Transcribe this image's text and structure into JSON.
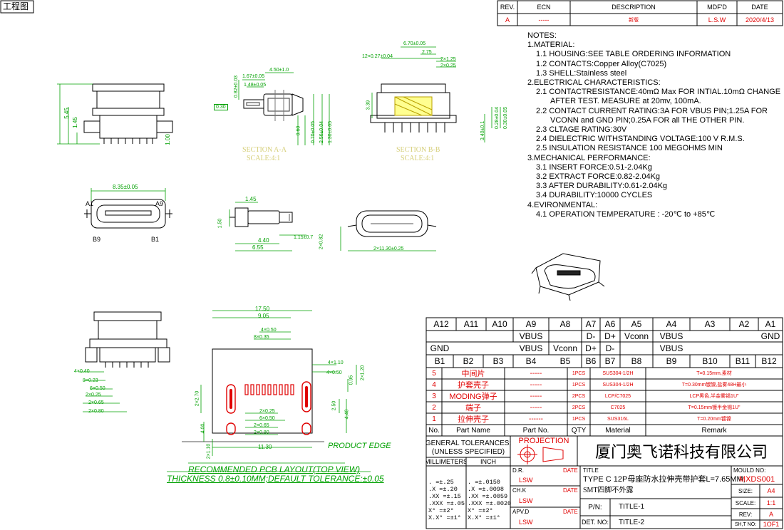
{
  "corner_tag": "工程图",
  "revision": {
    "headers": [
      "REV.",
      "ECN",
      "DESCRIPTION",
      "MDF'D",
      "DATE"
    ],
    "row": [
      "A",
      "-----",
      "新版",
      "L.S.W",
      "2020/4/13"
    ]
  },
  "notes": [
    "NOTES:",
    "1.MATERIAL:",
    "1.1 HOUSING:SEE TABLE ORDERING INFORMATION",
    "1.2 CONTACTS:Copper Alloy(C7025)",
    "1.3 SHELL:Stainless steel",
    "2.ELECTRICAL CHARACTERISTICS:",
    "2.1 CONTACTRESISTANCE:40mΩ Max FOR INTIAL.10mΩ CHANGE",
    "AFTER TEST. MEASURE at 20mv, 100mA.",
    "2.2 CONTACT CURRENT RATING:3A FOR VBUS PIN;1.25A FOR",
    "VCONN and GND PIN;0.25A FOR all THE OTHER PIN.",
    "2.3 CLTAGE RATING:30V",
    "2.4 DIELECTRIC WITHSTANDING VOLTAGE:100 V R.M.S.",
    "2.5 INSULATION RESISTANCE 100 MEGOHMS MIN",
    "3.MECHANICAL PERFORMANCE:",
    "3.1 INSERT FORCE:0.51-2.04Kg",
    "3.2 EXTRACT FORCE:0.82-2.04Kg",
    "3.3 AFTER DURABILITY:0.61-2.04Kg",
    "3.4 DURABILITY:10000 CYCLES",
    "4.EVIRONMENTAL:",
    "4.1 OPERATION TEMPERATURE : -20℃ to +85℃"
  ],
  "section_labels": {
    "a": "SECTION A-A",
    "a_scale": "SCALE:4:1",
    "b": "SECTION B-B",
    "b_scale": "SCALE:4:1"
  },
  "dims": {
    "d545": "5.45",
    "d145": "1.45",
    "d100": "1.00",
    "d167": "1.67±0.05",
    "d450": "4.50±1.0",
    "d082": "0.82±0.03",
    "d148": "1.48±0.05",
    "d030": "0.30",
    "d060": "0.60",
    "d070": "0.70±0.05",
    "d256": "2.56±0.04",
    "d130": "1.30±0.05",
    "d670": "6.70±0.05",
    "d12x": "12×0.27±0.04",
    "d275": "2.75",
    "d2x125": "2×1.25",
    "d2x025": "2×0.25",
    "d339": "3.39",
    "d028": "0.28±0.04",
    "d030b": "0.30±0.05",
    "d340": "3.40±0.1",
    "d835": "8.35±0.05",
    "pA1": "A1",
    "pA9": "A9",
    "pB9": "B9",
    "pB1": "B1",
    "e145": "1.45",
    "e150": "1.50",
    "e440": "4.40",
    "e655": "6.55",
    "e115": "1.15±0.7",
    "e2x082": "2×0.82",
    "e2x113": "2×11.30±0.25",
    "f1750": "17.50",
    "f905": "9.05",
    "f4x050": "4×0.50",
    "f8x035": "8×0.35",
    "f4x110": "4×1.10",
    "f4x050b": "4×0.50",
    "f2x120": "2×1.20",
    "f095": "0.95",
    "f4x040": "4×0.40",
    "f8x023": "8×0.23",
    "f6x050": "6×0.50",
    "f2x025": "2×0.25",
    "f2x065": "2×0.65",
    "f2x080": "2×0.80",
    "f2x270": "2×2.70",
    "f250": "2.50",
    "f440": "4.40",
    "f400": "4.00",
    "f2x025b": "2×0.25",
    "f6x050b": "6×0.50",
    "f2x065b": "2×0.65",
    "f2x080b": "2×0.80",
    "f2x110": "2×1.10",
    "f1130": "11.30",
    "product_edge": "PRODUCT EDGE",
    "pcb_title": "RECOMMENDED PCB LAYOUT(TOP VIEW)",
    "pcb_sub": "THICKNESS 0.8±0.10MM;DEFAULT TOLERANCE:±0.05"
  },
  "pinout": {
    "row1": [
      "A12",
      "A11",
      "A10",
      "A9",
      "A8",
      "A7",
      "A6",
      "A5",
      "A4",
      "A3",
      "A2",
      "A1"
    ],
    "row2": [
      "",
      "",
      "",
      "VBUS",
      "",
      "D-",
      "D+",
      "Vconn",
      "VBUS",
      "",
      "",
      "GND"
    ],
    "row3": [
      "GND",
      "",
      "",
      "VBUS",
      "Vconn",
      "D+",
      "D-",
      "",
      "VBUS",
      "",
      "",
      ""
    ],
    "row4": [
      "B1",
      "B2",
      "B3",
      "B4",
      "B5",
      "B6",
      "B7",
      "B8",
      "B9",
      "B10",
      "B11",
      "B12"
    ]
  },
  "bom": {
    "rows": [
      [
        "5",
        "中间片",
        "-----",
        "1PCS",
        "SUS304-1/2H",
        "T=0.15mm,素材"
      ],
      [
        "4",
        "护套壳子",
        "-----",
        "1PCS",
        "SUS304-1/2H",
        "T=0.30mm镀镍,盐雾48H最小"
      ],
      [
        "3",
        "MODING弹子",
        "-----",
        "2PCS",
        "LCP/C7025",
        "LCP黑色,半金雾锡1U\""
      ],
      [
        "2",
        "端子",
        "-----",
        "2PCS",
        "C7025",
        "T=0.15mm镀半金锡1U\""
      ],
      [
        "1",
        "拉伸壳子",
        "------",
        "1PCS",
        "SUS316L",
        "T=0.20mm镀镍"
      ]
    ],
    "headers": [
      "No.",
      "Part Name",
      "Part No.",
      "QTY",
      "Material",
      "Remark"
    ]
  },
  "titleblock": {
    "general": "GENERAL TOLERANCES:",
    "unless": "(UNLESS SPECIFIED)",
    "millimeters": "MILLIMETERS",
    "inch": "INCH",
    "tol_mm": [
      ".  =±.25",
      ".X  =±.20",
      ".XX =±.15",
      ".XXX =±.05",
      "X°  =±2°",
      "X.X° =±1°"
    ],
    "tol_in": [
      ".   =±.0150",
      ".X  =±.0098",
      ".XX =±.0059",
      ".XXX =±.0020",
      "X°  =±2°",
      "X.X° =±1°"
    ],
    "projection": "PROJECTION",
    "company": "厦门奥飞诺科技有限公司",
    "dr": "D.R.",
    "ch": "CH.K",
    "apv": "APV.D",
    "date": "DATE",
    "lsw": "LSW",
    "title_lbl": "TITLE",
    "title_line1": "TYPE C 12P母座防水拉伸壳带护套L=7.65MM,",
    "title_line2": "SMT四脚不外露",
    "pn": "P/N:",
    "title1": "TITLE-1",
    "detno": "DET. NO:",
    "title2": "TITLE-2",
    "mould": "MOULD NO:",
    "mould_val": "MXDS001",
    "size": "SIZE:",
    "size_val": "A4",
    "scale": "SCALE:",
    "scale_val": "1:1",
    "rev": "REV:",
    "rev_val": "A",
    "sht": "SH,T NO:",
    "sht_val": "1OF1"
  },
  "colors": {
    "dim": "#00a000",
    "red": "#e00000",
    "line": "#000000"
  }
}
